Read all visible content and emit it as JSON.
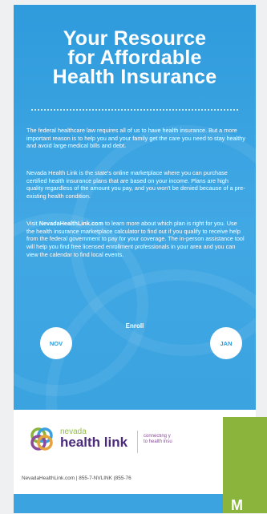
{
  "headline": {
    "line1": "Your Resource",
    "line2": "for Affordable",
    "line3": "Health Insurance"
  },
  "paragraphs": {
    "p1": "The federal healthcare law requires all of us to have health insurance. But a more important reason is to help you and your family get the care you need to stay healthy and avoid large medical bills and debt.",
    "p2": "Nevada Health Link is the state's online marketplace where you can purchase certified health insurance plans that are based on your income. Plans are high quality regardless of the amount you pay, and you won't be denied because of a pre-existing health condition.",
    "p3_before": "Visit ",
    "p3_link": "NevadaHealthLink.com",
    "p3_after": " to learn more about which plan is right for you. Use the health insurance marketplace calculator to find out if you qualify to receive help from the federal government to pay for your coverage. The in-person assistance tool will help you find free licensed enrollment professionals in your area and you can view the calendar to find local events."
  },
  "enrollment": {
    "label": "Enroll",
    "start": "NOV",
    "end": "JAN"
  },
  "brand": {
    "small": "nevada",
    "big": "health link",
    "tagline_line1": "connecting y",
    "tagline_line2": "to health insu",
    "contact": "NevadaHealthLink.com  |  855-7-NVLINK (855-76"
  },
  "green_card": {
    "letter": "M"
  },
  "colors": {
    "blue": "#3aa0de",
    "purple": "#4b2a7a",
    "green": "#8ab43b"
  },
  "icons": {
    "logo": "interlocking-rings-logo-icon"
  }
}
